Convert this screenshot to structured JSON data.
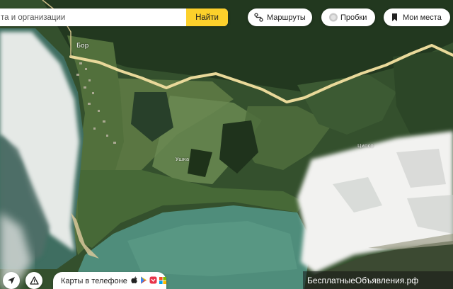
{
  "search": {
    "placeholder": "та и организации",
    "button_label": "Найти"
  },
  "top_buttons": {
    "routes_label": "Маршруты",
    "traffic_label": "Пробки",
    "my_places_label": "Мои места"
  },
  "map": {
    "place_labels": {
      "village": "Бор",
      "small_1": "Ушка",
      "small_2": "Ципсо"
    }
  },
  "bottom": {
    "app_promo_label": "Карты в телефоне",
    "icons": [
      "location-icon",
      "warning-icon",
      "apple-icon",
      "android-icon",
      "huawei-icon",
      "windows-icon"
    ]
  },
  "watermark": "БесплатныеОбъявления.рф",
  "colors": {
    "search_button": "#fcd02b",
    "road": "#e9d99a",
    "forest": "#2f4a2a",
    "water": "#4f8d7b",
    "snow": "#f2f2f0"
  }
}
